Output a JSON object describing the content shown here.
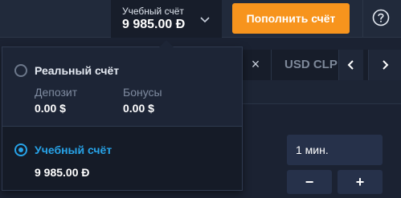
{
  "header": {
    "account_title": "Учебный счёт",
    "account_balance": "9 985.00 Đ",
    "deposit_button": "Пополнить счёт",
    "chevron_icon": "chevron-down-icon",
    "help_icon": "question-icon"
  },
  "tabs": {
    "close_glyph": "×",
    "asset_label": "USD CLP",
    "prev_icon": "chevron-left-icon",
    "next_icon": "chevron-right-icon"
  },
  "controls": {
    "time_value": "1 мин.",
    "minus_label": "−",
    "plus_label": "+"
  },
  "account_menu": {
    "real": {
      "label": "Реальный счёт",
      "selected": false,
      "deposit_label": "Депозит",
      "deposit_value": "0.00 $",
      "bonus_label": "Бонусы",
      "bonus_value": "0.00 $"
    },
    "demo": {
      "label": "Учебный счёт",
      "selected": true,
      "balance": "9 985.00 Đ"
    }
  },
  "colors": {
    "accent_orange": "#f7941d",
    "accent_blue": "#27a3e8",
    "background": "#1b2232"
  }
}
